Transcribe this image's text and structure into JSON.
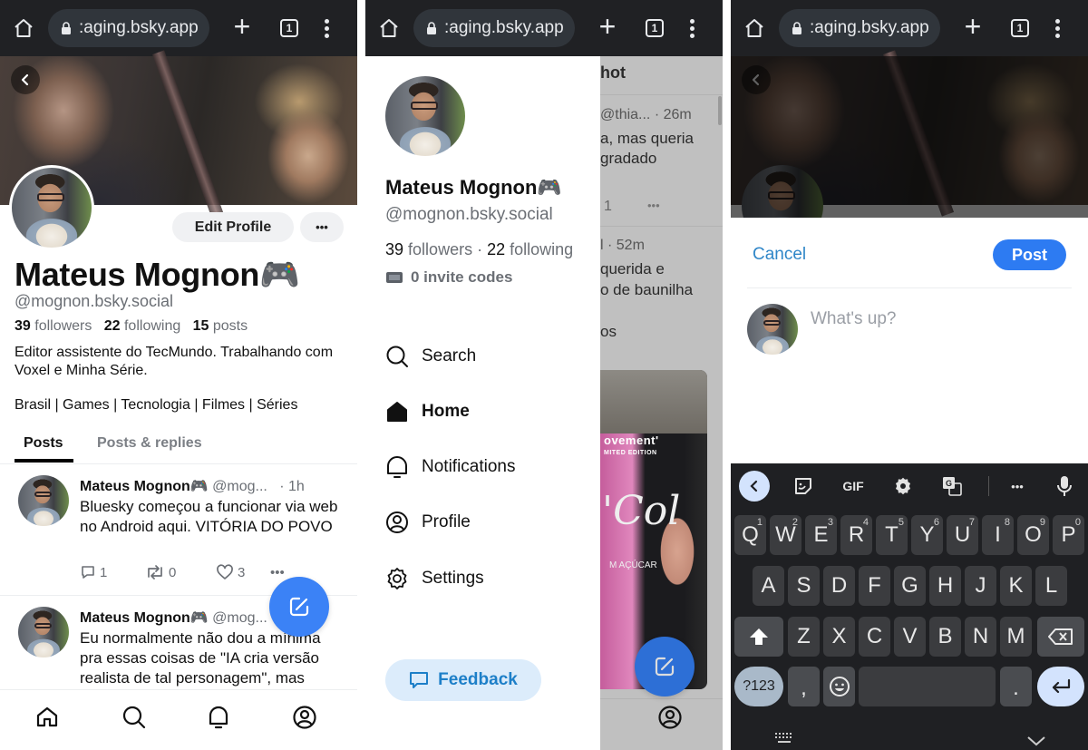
{
  "browser": {
    "url": ":aging.bsky.app",
    "tab_count": "1",
    "icons": [
      "home-icon",
      "lock-icon",
      "new-tab-icon",
      "tab-switcher-icon",
      "overflow-menu-icon"
    ]
  },
  "profile_screen": {
    "display_name": "Mateus Mognon🎮",
    "handle": "@mognon.bsky.social",
    "edit_profile_label": "Edit Profile",
    "more_label": "•••",
    "followers_count": "39",
    "followers_label": "followers",
    "following_count": "22",
    "following_label": "following",
    "posts_count": "15",
    "posts_label": "posts",
    "bio_line1": "Editor assistente do TecMundo. Trabalhando com Voxel e Minha Série.",
    "bio_line2": "Brasil | Games | Tecnologia | Filmes | Séries",
    "tabs": [
      {
        "label": "Posts",
        "active": true
      },
      {
        "label": "Posts & replies",
        "active": false
      }
    ],
    "posts": [
      {
        "author": "Mateus Mognon🎮",
        "handle": "@mog...",
        "time": "· 1h",
        "text": "Bluesky começou a funcionar via web no Android aqui. VITÓRIA DO POVO",
        "replies": "1",
        "reposts": "0",
        "likes": "3"
      },
      {
        "author": "Mateus Mognon🎮",
        "handle": "@mog...",
        "time": "",
        "text": "Eu normalmente não dou a mínima pra essas coisas de \"IA cria versão realista de tal personagem\", mas"
      }
    ],
    "bottom_nav": [
      "home",
      "search",
      "notifications",
      "profile"
    ]
  },
  "drawer_screen": {
    "display_name": "Mateus Mognon🎮",
    "handle": "@mognon.bsky.social",
    "followers_count": "39",
    "followers_label": "followers",
    "separator": "·",
    "following_count": "22",
    "following_label": "following",
    "invite_codes": "0 invite codes",
    "menu": [
      {
        "label": "Search",
        "icon": "search-icon",
        "active": false
      },
      {
        "label": "Home",
        "icon": "home-icon",
        "active": true
      },
      {
        "label": "Notifications",
        "icon": "bell-icon",
        "active": false
      },
      {
        "label": "Profile",
        "icon": "user-circle-icon",
        "active": false
      },
      {
        "label": "Settings",
        "icon": "gear-icon",
        "active": false
      }
    ],
    "feedback_label": "Feedback",
    "background_feed": {
      "header_fragment": "hot",
      "post1_meta": "@thia... · 26m",
      "post1_line1": "a, mas queria",
      "post1_line2": "gradado",
      "post1_count": "1",
      "post1_more": "•••",
      "post2_meta": "l · 52m",
      "post2_line1": "querida e",
      "post2_line2": "o de baunilha",
      "post2_line3": "os",
      "photo_text_1": "ovement'",
      "photo_text_2": "MITED EDITION",
      "photo_text_3": "'Col",
      "photo_text_4": "M AÇÚCAR"
    }
  },
  "composer_screen": {
    "cancel_label": "Cancel",
    "post_label": "Post",
    "placeholder": "What's up?",
    "accent_color": "#2d7bf2"
  },
  "keyboard": {
    "toolbar": [
      "back",
      "sticker",
      "GIF",
      "settings",
      "translate",
      "more",
      "mic"
    ],
    "gif_label": "GIF",
    "more_label": "•••",
    "row1": [
      [
        "Q",
        "1"
      ],
      [
        "W",
        "2"
      ],
      [
        "E",
        "3"
      ],
      [
        "R",
        "4"
      ],
      [
        "T",
        "5"
      ],
      [
        "Y",
        "6"
      ],
      [
        "U",
        "7"
      ],
      [
        "I",
        "8"
      ],
      [
        "O",
        "9"
      ],
      [
        "P",
        "0"
      ]
    ],
    "row2": [
      "A",
      "S",
      "D",
      "F",
      "G",
      "H",
      "J",
      "K",
      "L"
    ],
    "row3": [
      "Z",
      "X",
      "C",
      "V",
      "B",
      "N",
      "M"
    ],
    "symbols_label": "?123",
    "comma_label": ",",
    "period_label": "."
  }
}
